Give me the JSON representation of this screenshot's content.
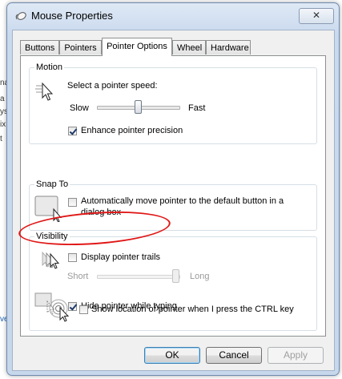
{
  "window": {
    "title": "Mouse Properties",
    "close_label": "✕"
  },
  "tabs": [
    {
      "label": "Buttons",
      "active": false
    },
    {
      "label": "Pointers",
      "active": false
    },
    {
      "label": "Pointer Options",
      "active": true
    },
    {
      "label": "Wheel",
      "active": false
    },
    {
      "label": "Hardware",
      "active": false
    }
  ],
  "motion": {
    "title": "Motion",
    "speed_label": "Select a pointer speed:",
    "slow_label": "Slow",
    "fast_label": "Fast",
    "speed_level": 0.5,
    "precision_label": "Enhance pointer precision",
    "precision_checked": true
  },
  "snap_to": {
    "title": "Snap To",
    "label_line1": "Automatically move pointer to the default button in a",
    "label_line2": "dialog box",
    "checked": false
  },
  "visibility": {
    "title": "Visibility",
    "trails_label": "Display pointer trails",
    "trails_checked": false,
    "short_label": "Short",
    "long_label": "Long",
    "trail_length_level": 1.0,
    "hide_label": "Hide pointer while typing",
    "hide_checked": true,
    "ctrl_label": "Show location of pointer when I press the CTRL key",
    "ctrl_checked": false
  },
  "buttons": {
    "ok": "OK",
    "cancel": "Cancel",
    "apply": "Apply"
  },
  "behind": {
    "fragments": [
      "na",
      "a",
      "ys",
      "ix",
      "t",
      "ve"
    ]
  },
  "colors": {
    "annotation": "#e11717",
    "default_button_border": "#3c7fb1"
  }
}
